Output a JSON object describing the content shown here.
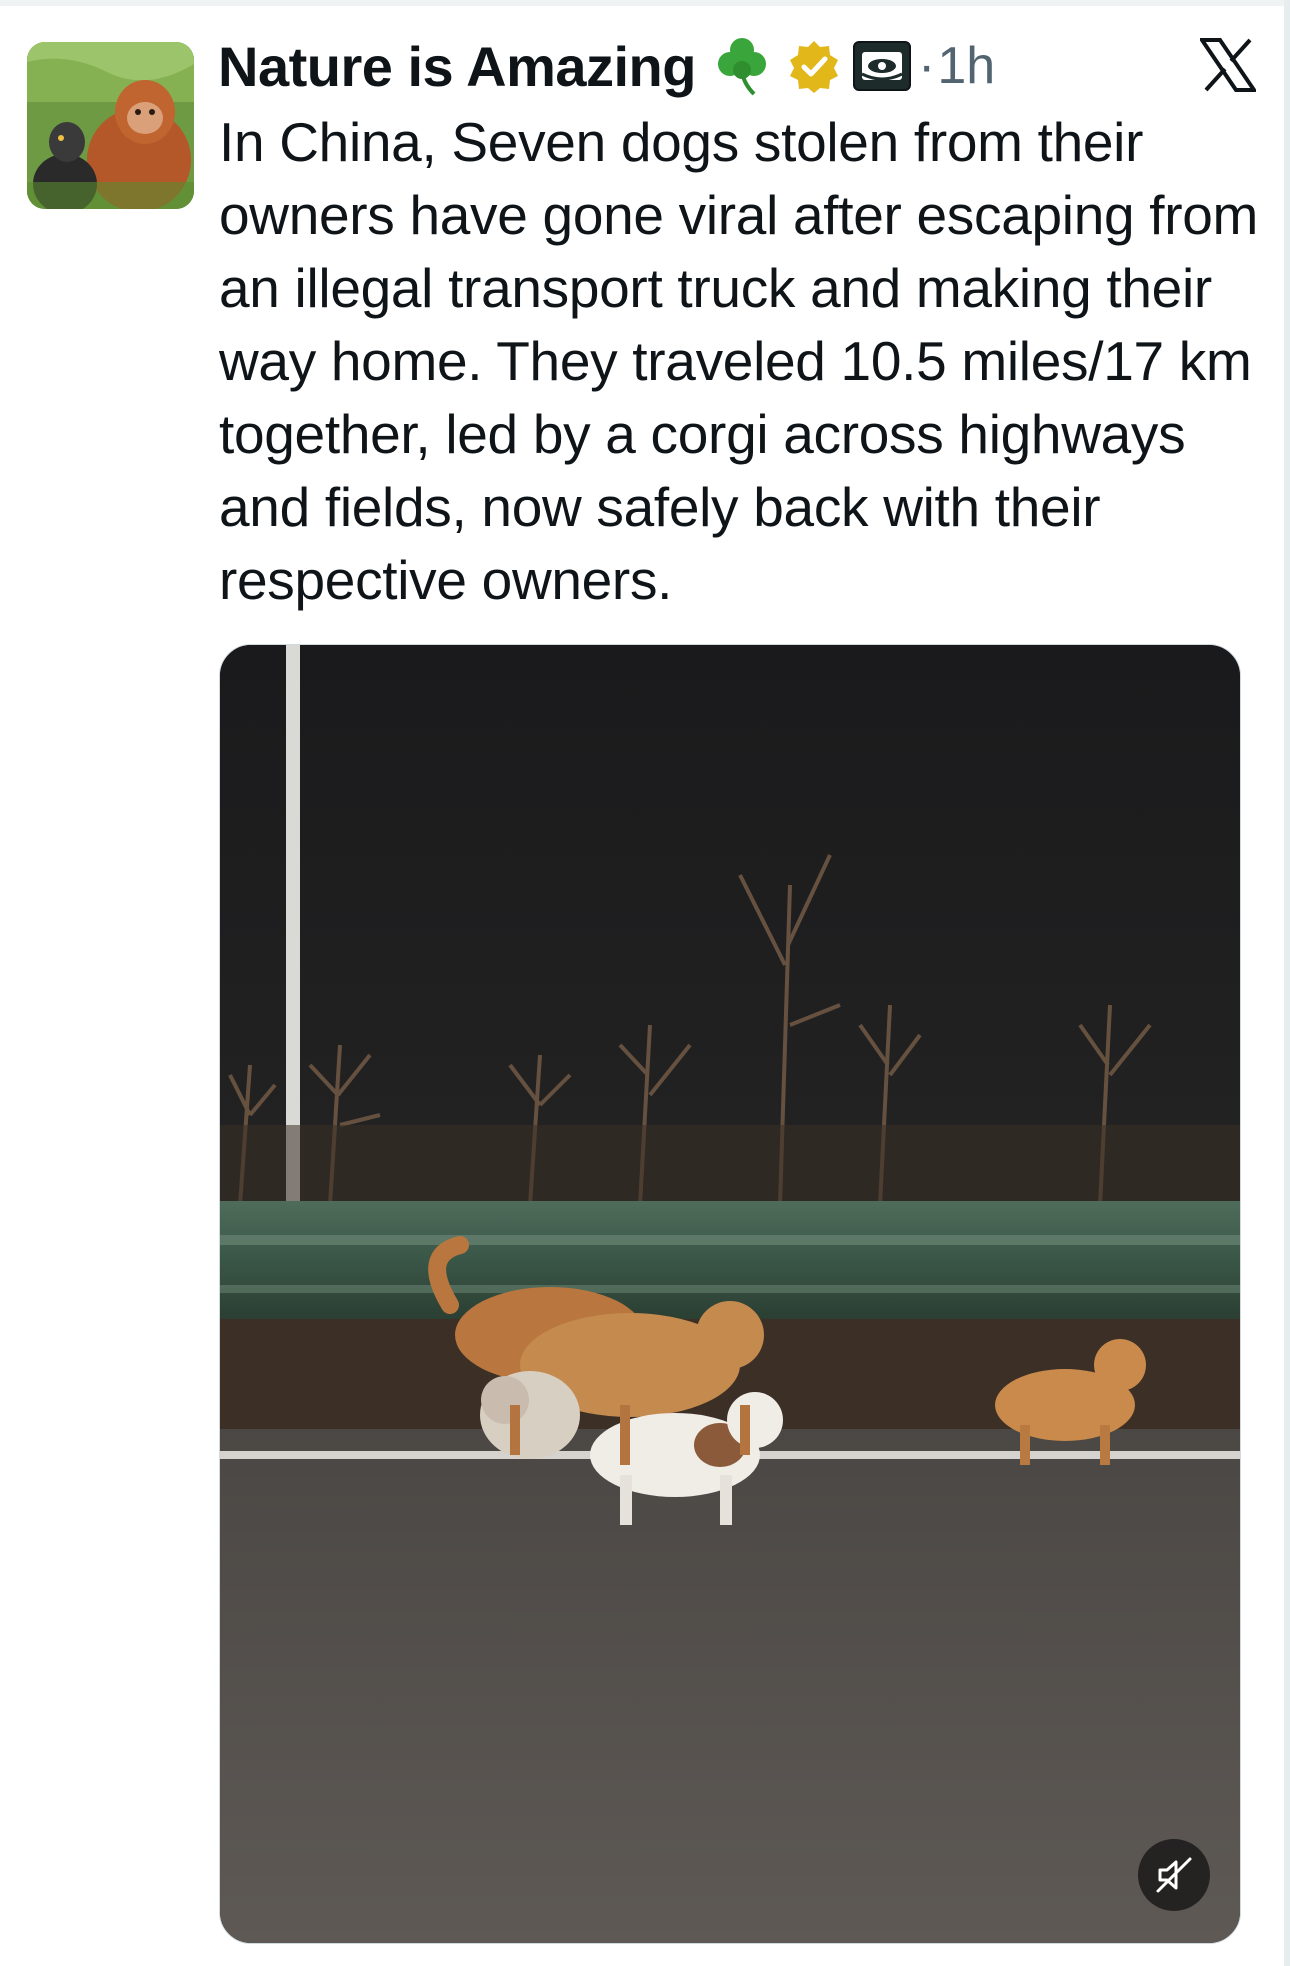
{
  "tweet": {
    "display_name": "Nature is Amazing",
    "name_emoji": "shamrock-emoji",
    "verified_icon": "verified-badge-icon",
    "affiliate_icon": "affiliate-badge-icon",
    "separator": "·",
    "timestamp": "1h",
    "text": "In China, Seven dogs stolen from their owners have gone viral after escaping from an illegal transport truck and making their way home. They traveled 10.5 miles/17 km together, led by a corgi across highways and fields, now safely back with their respective owners.",
    "media": {
      "type": "video",
      "mute_icon": "muted-speaker-icon"
    }
  },
  "app": {
    "logo": "x-logo-icon"
  },
  "colors": {
    "text_primary": "#0f1419",
    "text_secondary": "#536471",
    "verified_gold": "#e2b719",
    "shamrock_green": "#3aa53a"
  }
}
